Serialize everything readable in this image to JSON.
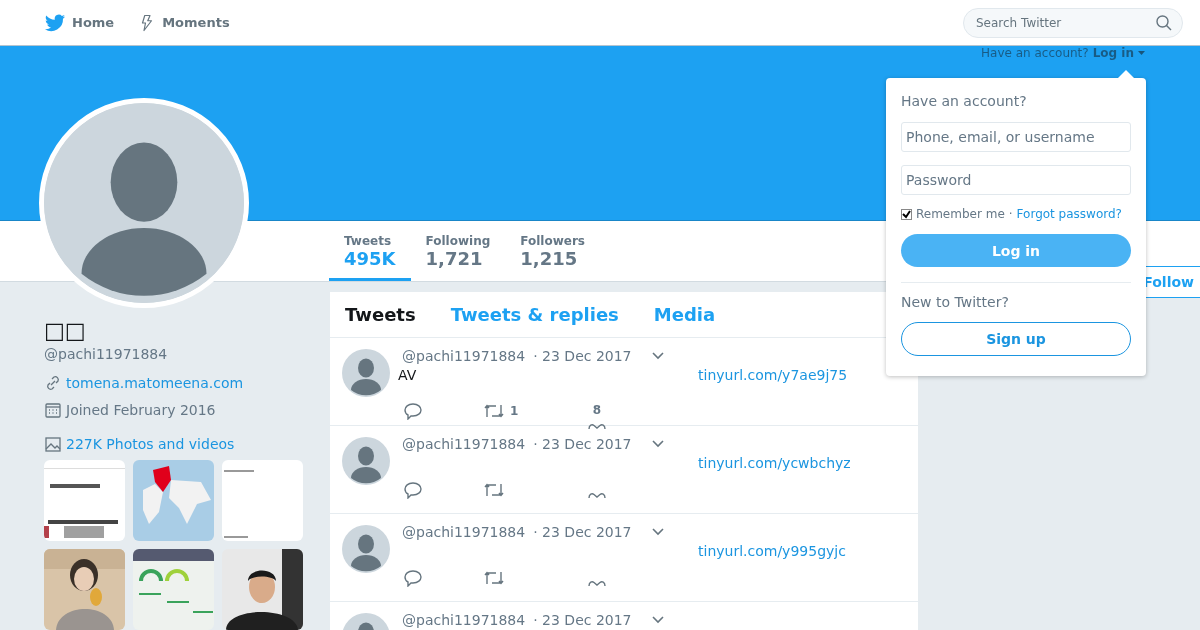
{
  "nav": {
    "items": [
      {
        "label": "Home"
      },
      {
        "label": "Moments"
      }
    ],
    "search": {
      "placeholder": "Search Twitter"
    }
  },
  "login_prompt": {
    "text": "Have an account?",
    "link": "Log in"
  },
  "profile": {
    "name": "□□",
    "handle": "@pachi11971884",
    "website": "tomena.matomeena.com",
    "joined": "Joined February 2016",
    "photos_link": "227K Photos and videos"
  },
  "stats": [
    {
      "label": "Tweets",
      "value": "495K",
      "selected": true
    },
    {
      "label": "Following",
      "value": "1,721",
      "selected": false
    },
    {
      "label": "Followers",
      "value": "1,215",
      "selected": false
    }
  ],
  "follow_button": "Follow",
  "timeline": {
    "tabs": [
      {
        "label": "Tweets",
        "selected": true
      },
      {
        "label": "Tweets & replies",
        "selected": false
      },
      {
        "label": "Media",
        "selected": false
      }
    ],
    "tweets": [
      {
        "handle": "@pachi11971884",
        "date": "· 23 Dec 2017",
        "text": "AV",
        "link": "tinyurl.com/y7ae9j75",
        "retweets": "1",
        "likes": "8",
        "actions_visible": true
      },
      {
        "handle": "@pachi11971884",
        "date": "· 23 Dec 2017",
        "link": "tinyurl.com/ycwbchyz",
        "actions_visible": true
      },
      {
        "handle": "@pachi11971884",
        "date": "· 23 Dec 2017",
        "link": "tinyurl.com/y995gyjc",
        "actions_visible": true
      },
      {
        "handle": "@pachi11971884",
        "date": "· 23 Dec 2017",
        "actions_visible": false
      }
    ]
  },
  "login_dropdown": {
    "title": "Have an account?",
    "username_placeholder": "Phone, email, or username",
    "password_placeholder": "Password",
    "remember_me": {
      "label": "Remember me",
      "checked": true
    },
    "separator": "·",
    "forgot_link": "Forgot password?",
    "login_button": "Log in",
    "signup_title": "New to Twitter?",
    "signup_button": "Sign up"
  }
}
